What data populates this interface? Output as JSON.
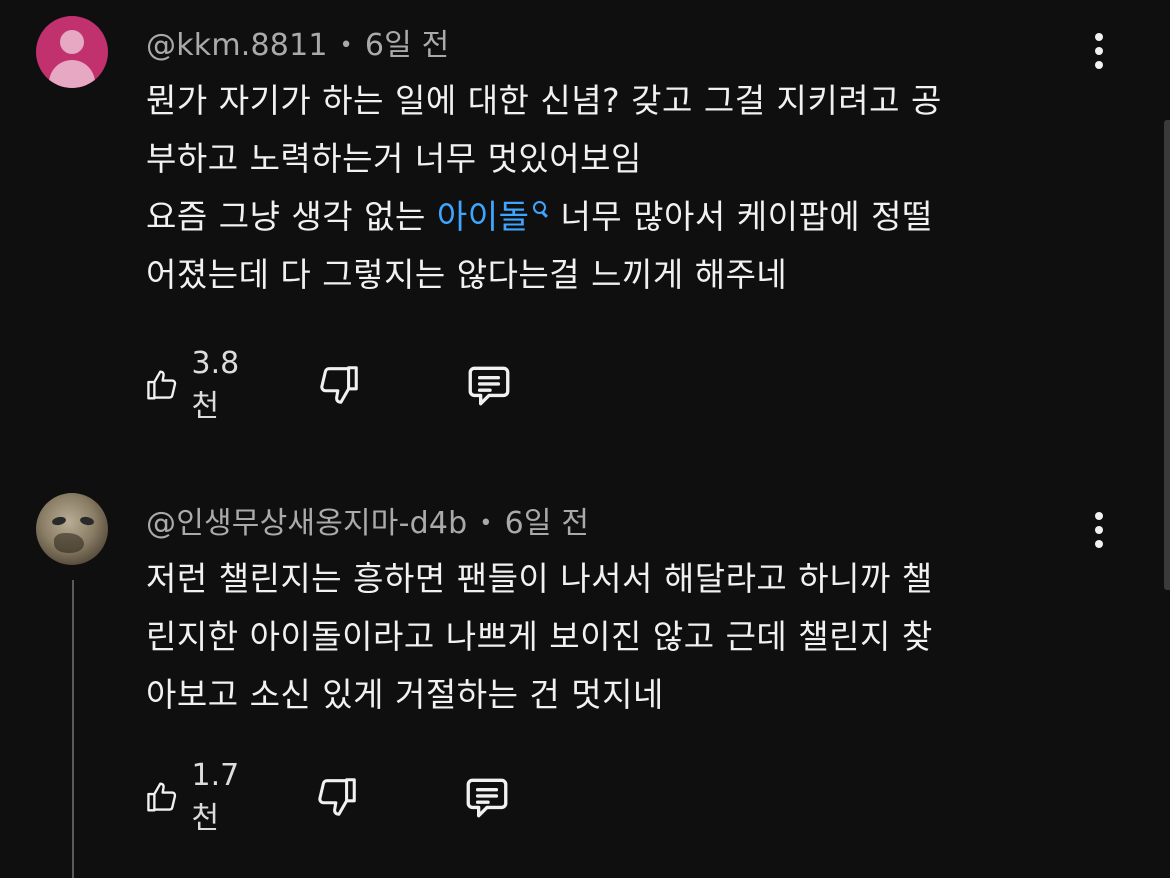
{
  "comments": [
    {
      "author": "@kkm.8811",
      "time": "6일 전",
      "lines": [
        "뭔가 자기가 하는 일에 대한 신념? 갖고 그걸 지키려고 공",
        "부하고 노력하는거 너무 멋있어보임"
      ],
      "line3_prefix": "요즘 그냥 생각 없는 ",
      "line3_link": "아이돌",
      "line3_suffix": "너무 많아서 케이팝에 정떨",
      "line4": "어졌는데 다 그렇지는 않다는걸 느끼게 해주네",
      "like_count": "3.8천",
      "avatar": "default-avatar-magenta"
    },
    {
      "author": "@인생무상새옹지마-d4b",
      "time": "6일 전",
      "lines": [
        "저런 챌린지는 흥하면 팬들이 나서서 해달라고 하니까 챌",
        "린지한 아이돌이라고 나쁘게 보이진 않고 근데 챌린지 찾",
        "아보고 소신 있게 거절하는 건 멋지네"
      ],
      "like_count": "1.7천",
      "avatar": "photo-avatar"
    }
  ],
  "icons": {
    "like": "thumbs-up-icon",
    "dislike": "thumbs-down-icon",
    "reply": "reply-comment-icon",
    "more": "more-vertical-icon",
    "link_search": "search-icon"
  },
  "colors": {
    "background": "#0f0f0f",
    "text": "#f1f1f1",
    "meta": "#aaaaaa",
    "link": "#3ea6ff",
    "avatar_magenta": "#c0316e"
  }
}
